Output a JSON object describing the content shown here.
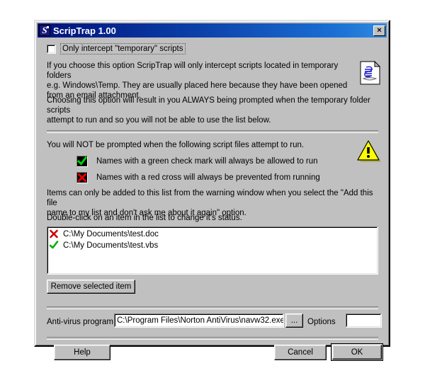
{
  "window": {
    "title": "ScripTrap 1.00",
    "icon": "scroll-s-icon",
    "close_label": "×"
  },
  "options": {
    "temporary_checkbox_label": "Only intercept \"temporary\" scripts",
    "temporary_checkbox_checked": false
  },
  "icons": {
    "document": "script-document-icon",
    "warning": "warning-triangle-icon"
  },
  "paragraphs": {
    "p1": "If you choose this option ScripTrap will only intercept scripts located in temporary folders\ne.g. Windows\\Temp. They are usually placed here because they have been opened\nfrom an email attachment.",
    "p2": "Choosing this option will result in you ALWAYS being prompted when the temporary folder scripts\nattempt to run and so you will not be able to use the list below.",
    "p3": "You will NOT be prompted when the following script files attempt to run.",
    "p4": "Items can only be added to this list from the warning window when you select the \"Add this file\nname to my list and don't ask me about it again\" option.",
    "p5": "Double-click on an item in the list to change it's status."
  },
  "legend": [
    {
      "mark": "green-check",
      "text": "Names with a green check mark will always be allowed to run"
    },
    {
      "mark": "red-cross",
      "text": "Names with a red cross will always be prevented from running"
    }
  ],
  "file_list": [
    {
      "status": "red-cross",
      "path": "C:\\My Documents\\test.doc"
    },
    {
      "status": "green-check",
      "path": "C:\\My Documents\\test.vbs"
    }
  ],
  "buttons": {
    "remove": "Remove selected item",
    "browse": "...",
    "help": "Help",
    "cancel": "Cancel",
    "ok": "OK"
  },
  "antivirus": {
    "label": "Anti-virus program",
    "path_value": "C:\\Program Files\\Norton AntiVirus\\navw32.exe",
    "path_placeholder": "",
    "options_label": "Options",
    "options_value": "",
    "options_placeholder": ""
  },
  "colors": {
    "titlebar_start": "#00107a",
    "titlebar_end": "#2f8ae0",
    "face": "#c0c0c0",
    "green_check": "#00c000",
    "red_cross": "#c00000",
    "warning_yellow": "#ffff00"
  }
}
